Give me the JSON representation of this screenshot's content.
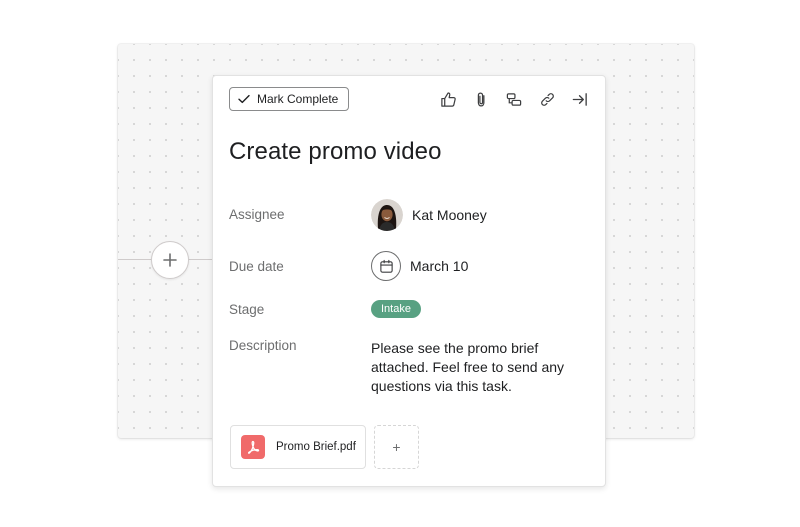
{
  "task": {
    "mark_complete_label": "Mark Complete",
    "title": "Create promo video",
    "toolbar_icons": [
      "thumbs-up-icon",
      "paperclip-icon",
      "subtask-icon",
      "link-icon",
      "close-panel-icon"
    ]
  },
  "fields": {
    "assignee": {
      "label": "Assignee",
      "value": "Kat Mooney"
    },
    "due_date": {
      "label": "Due date",
      "value": "March 10"
    },
    "stage": {
      "label": "Stage",
      "value": "Intake",
      "color": "#58a182"
    },
    "description": {
      "label": "Description",
      "value": "Please see the promo brief attached. Feel free to send any questions via this task."
    }
  },
  "attachments": {
    "items": [
      {
        "name": "Promo Brief.pdf",
        "icon": "pdf-icon",
        "color": "#f06a6a"
      }
    ],
    "add_label": "+"
  },
  "canvas": {
    "add_node_icon": "plus-icon"
  }
}
